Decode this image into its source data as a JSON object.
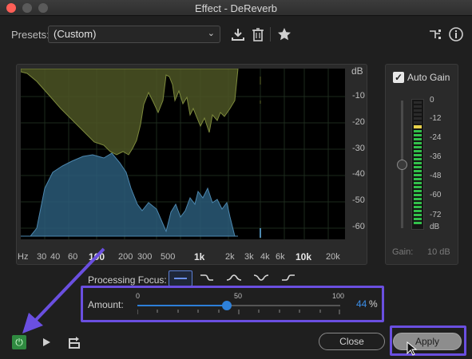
{
  "window": {
    "title": "Effect - DeReverb"
  },
  "presets": {
    "label": "Presets:",
    "value": "(Custom)"
  },
  "graph": {
    "db_title": "dB",
    "db_ticks": [
      "-10",
      "-20",
      "-30",
      "-40",
      "-50",
      "-60"
    ],
    "hz_unit": "Hz",
    "hz_ticks": [
      "30",
      "40",
      "60",
      "100",
      "200",
      "300",
      "500",
      "1k",
      "2k",
      "3k",
      "4k",
      "6k",
      "10k",
      "20k"
    ],
    "hz_ticks_bold": [
      "100",
      "1k",
      "10k"
    ]
  },
  "auto_gain": {
    "label": "Auto Gain",
    "checked": true,
    "meter_ticks": [
      "0",
      "-12",
      "-24",
      "-36",
      "-48",
      "-60",
      "-72",
      "dB"
    ],
    "gain_label": "Gain:",
    "gain_value": "10 dB"
  },
  "processing_focus": {
    "label": "Processing Focus:"
  },
  "amount": {
    "label": "Amount:",
    "scale_min": "0",
    "scale_mid": "50",
    "scale_max": "100",
    "value": 44,
    "value_text": "44",
    "unit": "%"
  },
  "buttons": {
    "close": "Close",
    "apply": "Apply"
  },
  "colors": {
    "accent_blue": "#2e81da",
    "highlight_purple": "#6a4fe0",
    "power_green": "#2f8a40",
    "spectrum_original": "#5f6a2a",
    "spectrum_processed": "#2e5f80"
  },
  "icons": {
    "preset_save": "download-icon",
    "preset_delete": "trash-icon",
    "favorite": "star-icon",
    "routing": "routing-icon",
    "info": "info-icon",
    "power": "power-icon",
    "play": "play-icon",
    "loop": "loop-icon"
  }
}
